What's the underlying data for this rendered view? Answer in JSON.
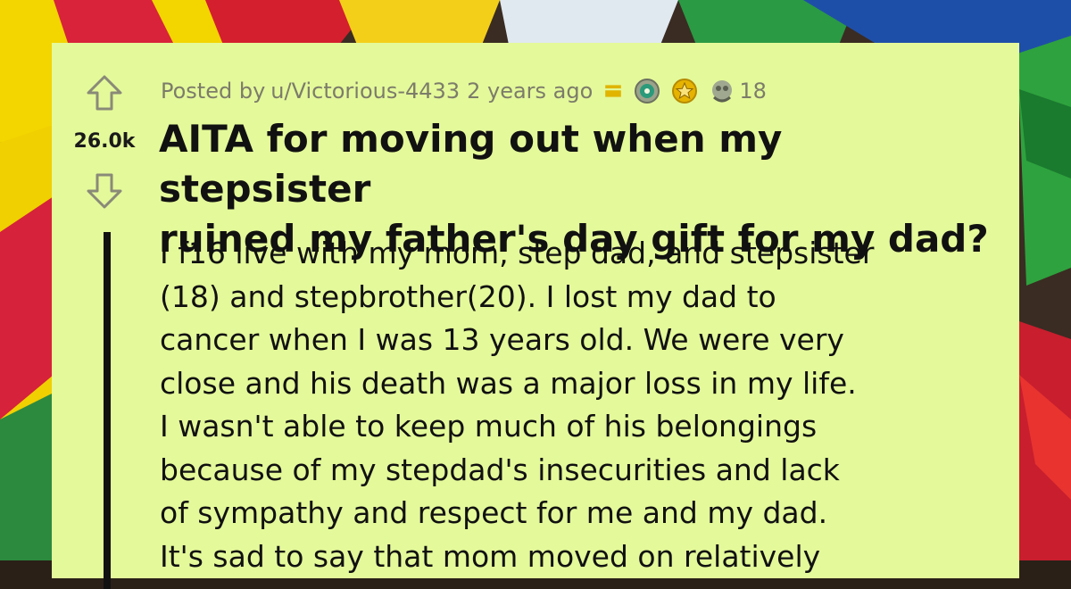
{
  "post": {
    "author_prefix": "Posted by",
    "username": "u/Victorious-4433",
    "age": "2 years ago",
    "award_count": "18",
    "score": "26.0k",
    "title_lines": [
      "AITA for moving out when my stepsister",
      "ruined my father's day gift for my dad?"
    ],
    "body_lines": [
      "I f16 live with my mom, step dad, and stepsister",
      "(18) and stepbrother(20). I lost my dad to",
      "cancer when I was 13 years old. We were very",
      "close and his death was a major loss in my life.",
      "I wasn't able to keep much of his belongings",
      "because of my stepdad's insecurities and lack",
      "of sympathy and respect for me and my dad.",
      "It's sad to say that mom moved on relatively"
    ]
  },
  "icons": {
    "upvote": "upvote-arrow-icon",
    "downvote": "downvote-arrow-icon",
    "mod_badge": "moderator-badge-icon",
    "award_1": "wholesome-award-icon",
    "award_2": "gold-star-award-icon",
    "award_3": "hugz-award-icon"
  },
  "colors": {
    "card_background": "#e4f99a",
    "meta_text": "#7c7c6a",
    "badge_gold": "#e0b400",
    "thread_line": "#111111"
  }
}
